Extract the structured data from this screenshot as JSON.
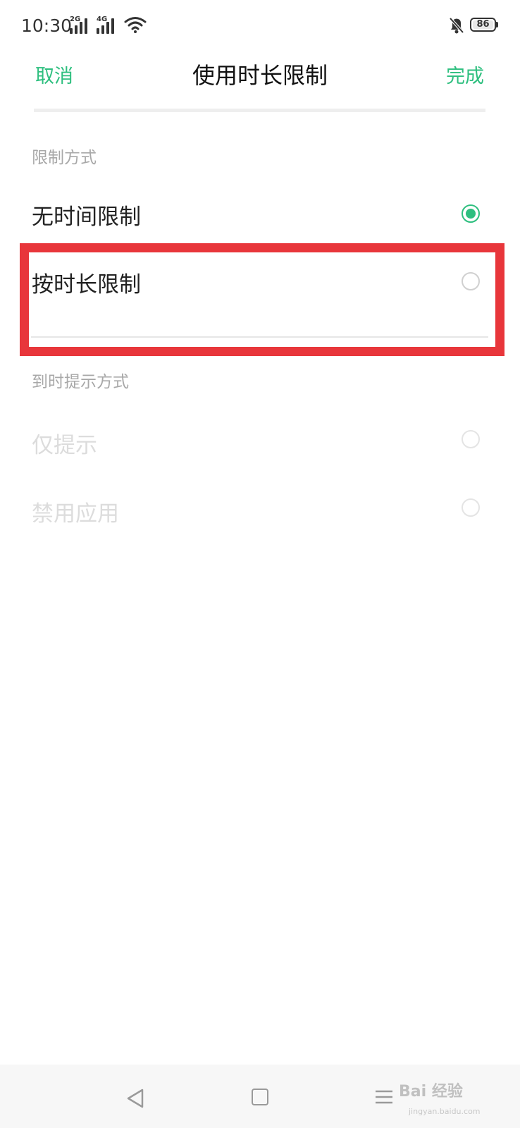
{
  "status_bar": {
    "time": "10:30",
    "network1": "2G",
    "network2": "4G",
    "battery": "86"
  },
  "header": {
    "cancel": "取消",
    "title": "使用时长限制",
    "done": "完成"
  },
  "limit_section": {
    "label": "限制方式",
    "options": [
      {
        "label": "无时间限制",
        "selected": true
      },
      {
        "label": "按时长限制",
        "selected": false
      }
    ]
  },
  "alert_section": {
    "label": "到时提示方式",
    "options": [
      {
        "label": "仅提示",
        "selected": false,
        "disabled": true
      },
      {
        "label": "禁用应用",
        "selected": false,
        "disabled": true
      }
    ]
  },
  "watermark": {
    "text": "Bai 经验",
    "sub": "jingyan.baidu.com"
  },
  "colors": {
    "accent": "#2ebf7f",
    "highlight": "#e8363b"
  }
}
